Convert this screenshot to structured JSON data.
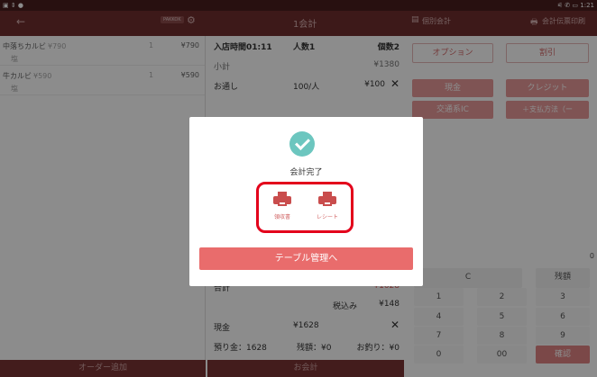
{
  "status_bar": {
    "right": "⚟ ✆ ▭ 1:21"
  },
  "header": {
    "badge": "PAKKOK",
    "title": "1会計",
    "split": "個別会計",
    "print_slip": "会計伝票印刷"
  },
  "order_items": [
    {
      "name": "中落ちカルビ",
      "unit": "¥790",
      "sub": "塩",
      "qty": "1",
      "price": "¥790"
    },
    {
      "name": "牛カルビ",
      "unit": "¥590",
      "sub": "塩",
      "qty": "1",
      "price": "¥590"
    }
  ],
  "summary": {
    "entry_label": "入店時間01:11",
    "people": "人数1",
    "count": "個数2",
    "subtotal_label": "小計",
    "subtotal": "¥1380",
    "otoshi_label": "お通し",
    "otoshi_rate": "100/人",
    "otoshi_price": "¥100",
    "total_label": "合計",
    "total": "¥1628",
    "tax_label": "税込み",
    "tax": "¥148",
    "cash_label": "現金",
    "cash": "¥1628",
    "deposit": "預り金：1628",
    "balance": "残額：¥0",
    "change": "お釣り：¥0"
  },
  "options": {
    "option": "オプション",
    "discount": "割引",
    "cash": "現金",
    "credit": "クレジット",
    "transit": "交通系IC",
    "add_method": "＋支払方法（ー"
  },
  "keypad": {
    "display": "0",
    "clear": "C",
    "remaining": "残額",
    "keys": [
      "1",
      "2",
      "3",
      "4",
      "5",
      "6",
      "7",
      "8",
      "9",
      "0",
      "00"
    ],
    "confirm": "確認"
  },
  "bottom": {
    "add_order": "オーダー追加",
    "checkout": "お会計"
  },
  "modal": {
    "done": "会計完了",
    "receipt_label": "領収書",
    "slip_label": "レシート",
    "go_table": "テーブル管理へ"
  }
}
